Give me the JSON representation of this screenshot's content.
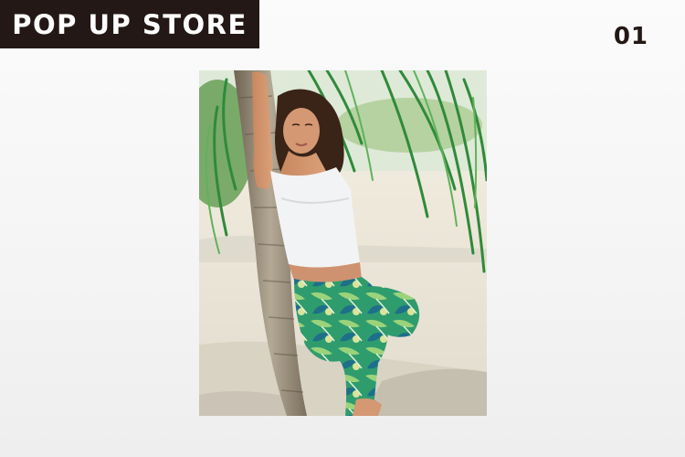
{
  "header": {
    "title": "POP UP STORE",
    "number": "01"
  },
  "photo": {
    "description_icon": "model-leaning-on-palm-tree-image"
  },
  "colors": {
    "title_band": "#231815",
    "title_text": "#ffffff",
    "number_text": "#231815",
    "page_background": "#f4f4f4"
  }
}
